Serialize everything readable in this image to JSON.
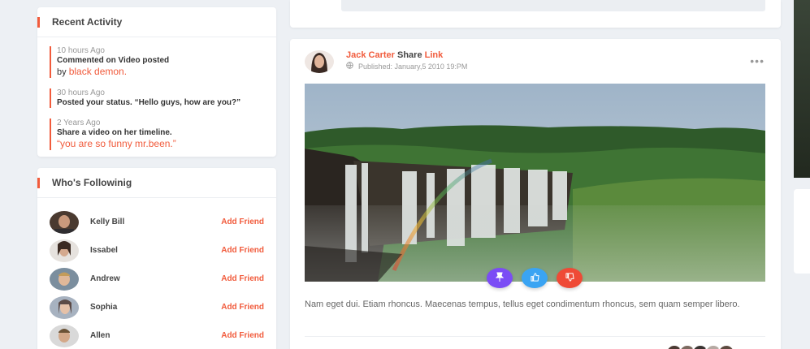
{
  "recent_activity": {
    "title": "Recent Activity",
    "items": [
      {
        "time": "10 hours Ago",
        "text": "Commented on Video posted",
        "prefix": "by ",
        "highlight": "black demon."
      },
      {
        "time": "30 hours Ago",
        "text": "Posted your status. “Hello guys, how are you?”"
      },
      {
        "time": "2 Years Ago",
        "text": "Share a video on her timeline.",
        "highlight": "you are so funny mr.been."
      }
    ]
  },
  "following": {
    "title": "Who's Followinig",
    "action_label": "Add Friend",
    "people": [
      {
        "name": "Kelly Bill"
      },
      {
        "name": "Issabel"
      },
      {
        "name": "Andrew"
      },
      {
        "name": "Sophia"
      },
      {
        "name": "Allen"
      }
    ]
  },
  "post": {
    "author": "Jack Carter",
    "action_word": "Share",
    "object_word": "Link",
    "published": "Published: January,5 2010 19:PM",
    "body": "Nam eget dui. Etiam rhoncus. Maecenas tempus, tellus eget condimentum rhoncus, sem quam semper libero.",
    "reactions": [
      "pin-icon",
      "thumbs-up-icon",
      "thumbs-down-icon"
    ]
  },
  "colors": {
    "accent": "#f15b3c",
    "pin": "#7b4cf5",
    "like": "#3aa4f3",
    "dislike": "#ef4a36"
  }
}
